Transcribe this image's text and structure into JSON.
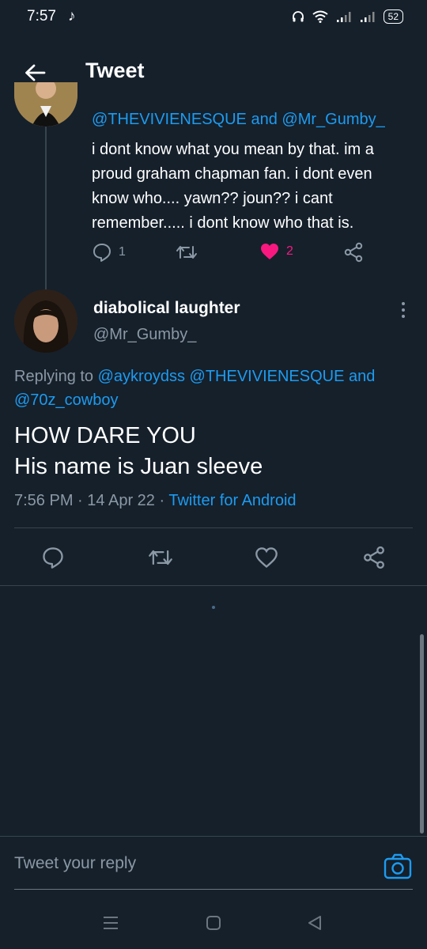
{
  "status_bar": {
    "time": "7:57",
    "music_glyph": "♪",
    "battery": "52"
  },
  "header": {
    "title": "Tweet"
  },
  "previous_tweet": {
    "replying_to": [
      "@THEVIVIENESQUE",
      "@Mr_Gumby_"
    ],
    "replying_joiner": "and",
    "body": "i dont know what you mean by that. im a proud graham chapman fan. i dont even know who.... yawn?? joun?? i cant remember..... i dont know who that is.",
    "reply_count": "1",
    "retweet_count": "",
    "like_count": "2",
    "liked": true
  },
  "main_tweet": {
    "display_name": "diabolical laughter",
    "handle": "@Mr_Gumby_",
    "replying_prefix": "Replying to",
    "replying_to": [
      "@aykroydss",
      "@THEVIVIENESQUE",
      "@70z_cowboy"
    ],
    "replying_joiner": "and",
    "text_line1": "HOW DARE YOU",
    "text_line2": "His name is Juan sleeve",
    "time": "7:56 PM",
    "date": "14 Apr 22",
    "separator": "·",
    "client": "Twitter for Android"
  },
  "reply_bar": {
    "placeholder": "Tweet your reply"
  },
  "colors": {
    "background": "#15202b",
    "accent": "#1d9bf0",
    "like": "#f91880",
    "secondary_text": "#8b98a5",
    "divider": "#38444d"
  },
  "icons": {
    "back": "arrow-left-icon",
    "reply": "speech-bubble-icon",
    "retweet": "retweet-icon",
    "like": "heart-icon",
    "share": "share-icon",
    "more": "kebab-menu-icon",
    "camera": "camera-icon",
    "nav_menu": "menu-icon",
    "nav_home": "home-square-icon",
    "nav_back": "triangle-back-icon"
  }
}
